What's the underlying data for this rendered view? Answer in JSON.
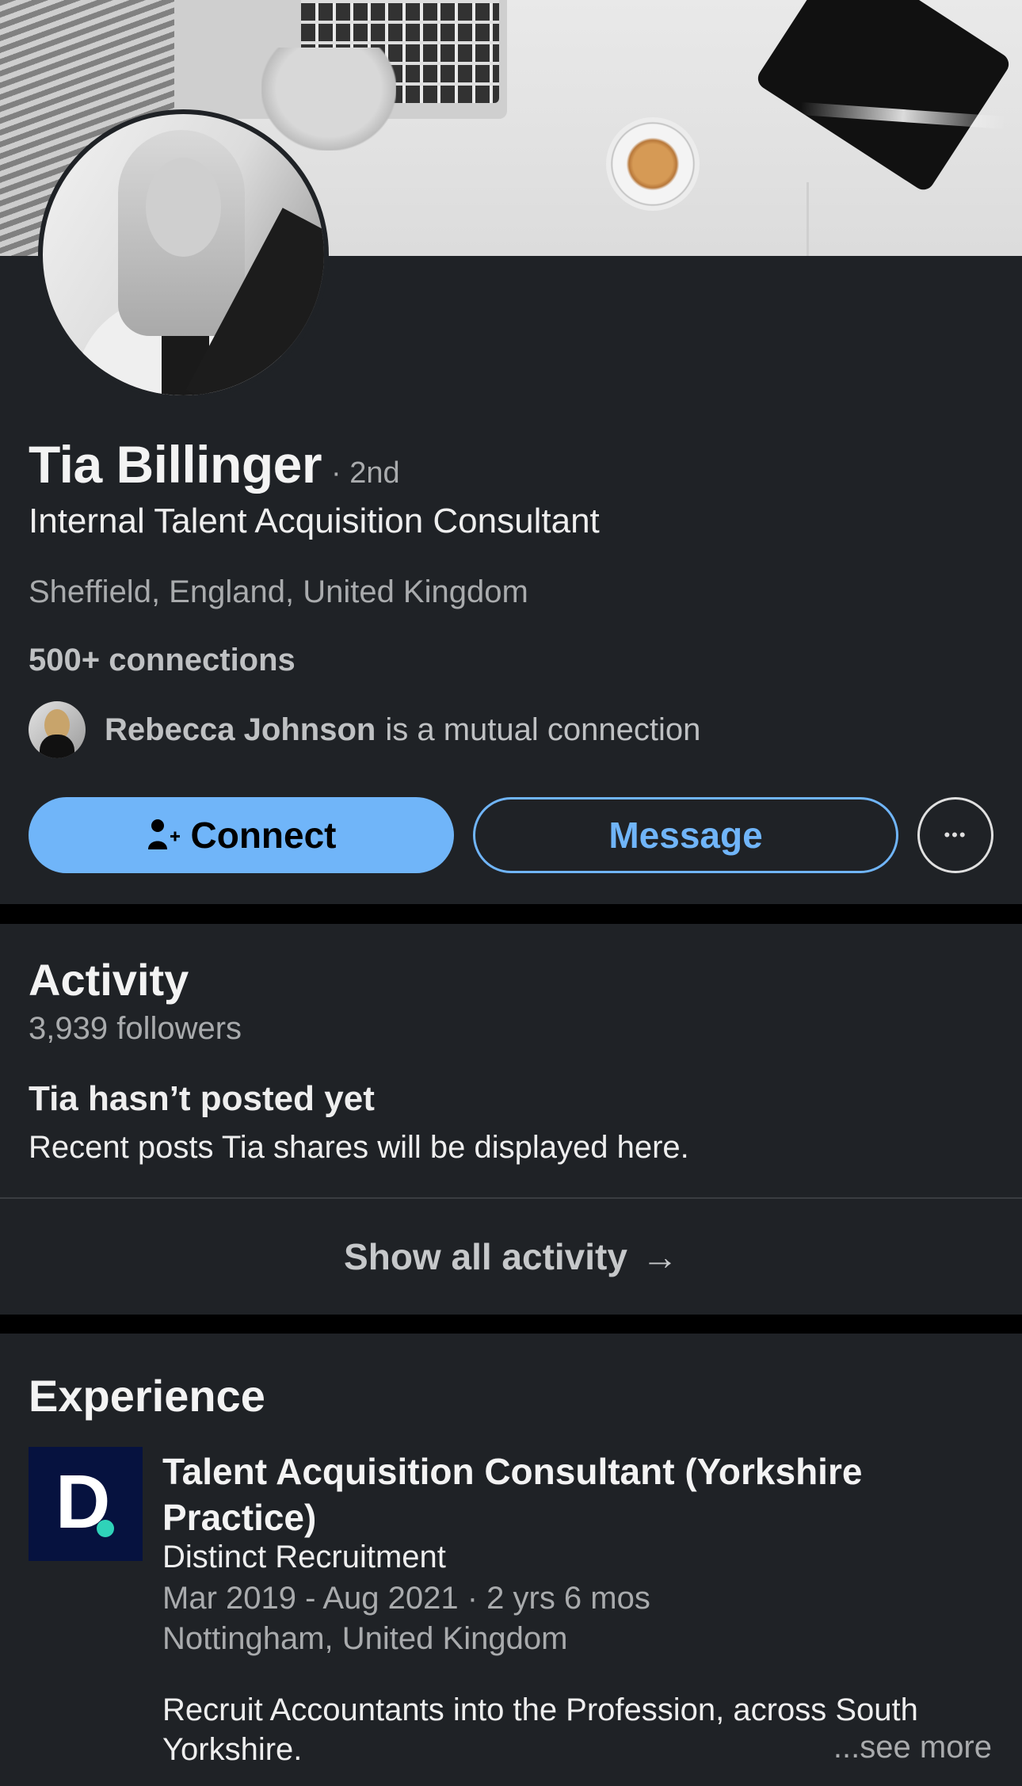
{
  "profile": {
    "name": "Tia Billinger",
    "degree": "· 2nd",
    "headline": "Internal Talent Acquisition Consultant",
    "location": "Sheffield, England, United Kingdom",
    "connections": "500+ connections",
    "mutual_name": "Rebecca Johnson",
    "mutual_text": "is a mutual connection"
  },
  "actions": {
    "connect_label": "Connect",
    "message_label": "Message",
    "more_label": "•••"
  },
  "activity": {
    "title": "Activity",
    "followers": "3,939 followers",
    "empty_title": "Tia hasn’t posted yet",
    "empty_sub": "Recent posts Tia shares will be displayed here.",
    "show_all": "Show all activity",
    "arrow": "→"
  },
  "experience": {
    "title": "Experience",
    "items": [
      {
        "logo_letter": "D",
        "title": "Talent Acquisition Consultant (Yorkshire Practice)",
        "company": "Distinct Recruitment",
        "dates": "Mar 2019 - Aug 2021 · 2 yrs 6 mos",
        "location": "Nottingham, United Kingdom",
        "description": "Recruit Accountants into the Profession, across South Yorkshire.",
        "see_more": "...see more"
      }
    ]
  },
  "colors": {
    "card_bg": "#1f2226",
    "accent": "#70b5f9",
    "separator": "#000000",
    "logo_bg": "#06123f",
    "logo_dot": "#2fd3b9"
  }
}
